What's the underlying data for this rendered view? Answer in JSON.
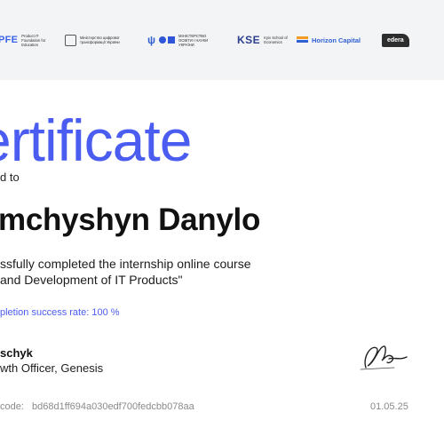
{
  "header": {
    "logos": [
      {
        "mark": "PFE",
        "text": "Product IT Foundation for Education"
      },
      {
        "text": "Міністерство цифрової трансформації України"
      },
      {
        "text": "МІНІСТЕРСТВО ОСВІТИ І НАУКИ УКРАЇНИ"
      },
      {
        "mark": "KSE",
        "text": "Kyiv School of Economics"
      },
      {
        "text": "Horizon Capital"
      },
      {
        "text": "edera"
      }
    ]
  },
  "certificate": {
    "title": "ertificate",
    "awarded_to": "d to",
    "recipient": "mchyshyn Danylo",
    "course_line1": "ssfully completed the internship online course",
    "course_line2": "and Development of IT Products\"",
    "success_rate": "pletion success rate: 100 %",
    "signer_name": "schyk",
    "signer_title": "wth Officer, Genesis",
    "code_label": "code:",
    "code_value": "bd68d1ff694a030edf700fedcbb078aa",
    "date": "01.05.25"
  },
  "colors": {
    "accent": "#4b5cf0",
    "header_background": "#f3f4f6",
    "muted_text": "#8a8a8a"
  }
}
